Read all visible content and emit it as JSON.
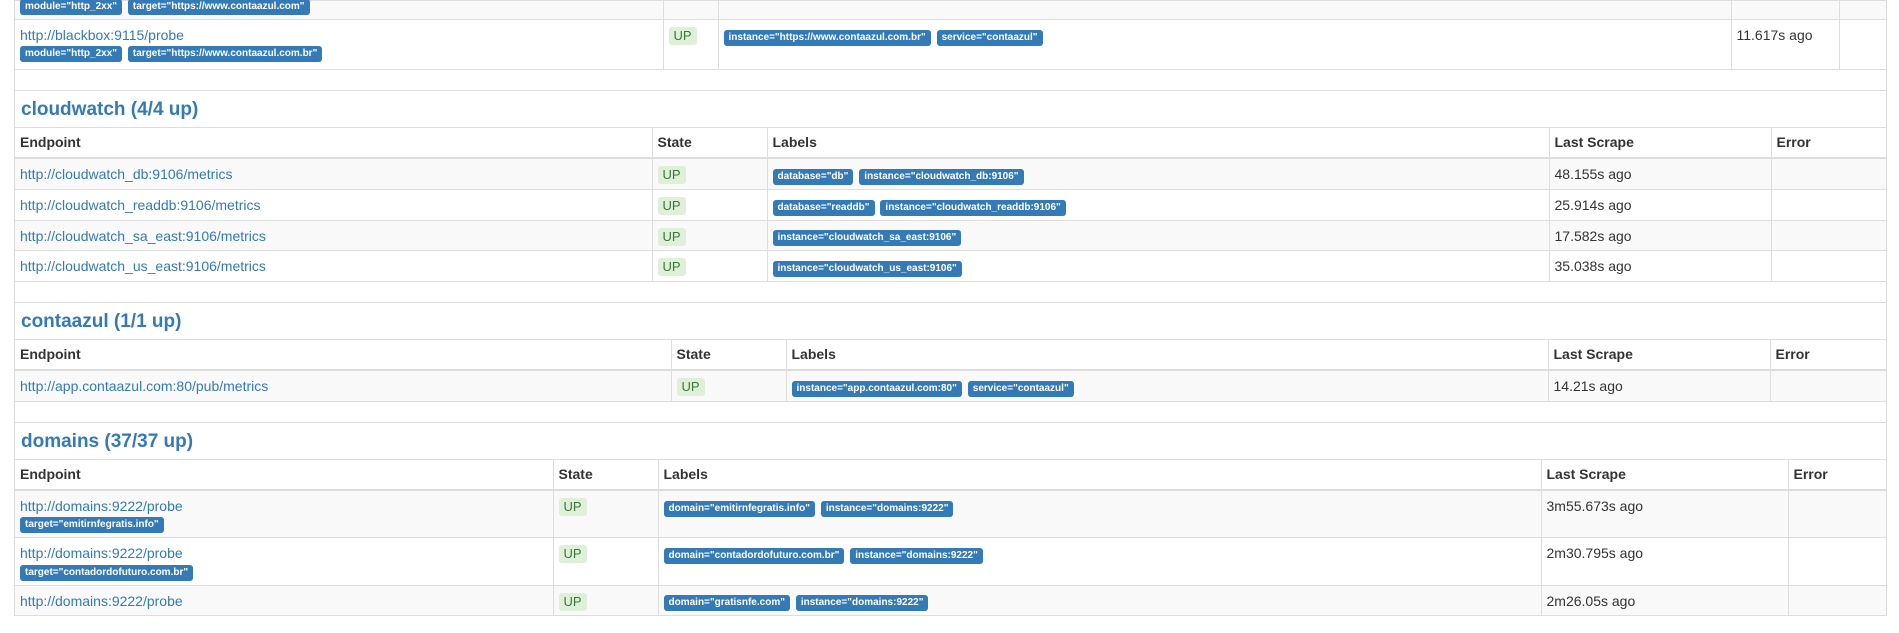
{
  "columns": {
    "endpoint": "Endpoint",
    "state": "State",
    "labels": "Labels",
    "last_scrape": "Last Scrape",
    "error": "Error"
  },
  "top_partial": {
    "row1": {
      "sublabels": [
        "module=\"http_2xx\"",
        "target=\"https://www.contaazul.com\""
      ]
    },
    "row2": {
      "endpoint": "http://blackbox:9115/probe",
      "sublabels": [
        "module=\"http_2xx\"",
        "target=\"https://www.contaazul.com.br\""
      ],
      "state": "UP",
      "labels": [
        "instance=\"https://www.contaazul.com.br\"",
        "service=\"contaazul\""
      ],
      "last_scrape": "11.617s ago"
    }
  },
  "jobs": [
    {
      "title": "cloudwatch (4/4 up)",
      "rows": [
        {
          "endpoint": "http://cloudwatch_db:9106/metrics",
          "state": "UP",
          "labels": [
            "database=\"db\"",
            "instance=\"cloudwatch_db:9106\""
          ],
          "last_scrape": "48.155s ago"
        },
        {
          "endpoint": "http://cloudwatch_readdb:9106/metrics",
          "state": "UP",
          "labels": [
            "database=\"readdb\"",
            "instance=\"cloudwatch_readdb:9106\""
          ],
          "last_scrape": "25.914s ago"
        },
        {
          "endpoint": "http://cloudwatch_sa_east:9106/metrics",
          "state": "UP",
          "labels": [
            "instance=\"cloudwatch_sa_east:9106\""
          ],
          "last_scrape": "17.582s ago"
        },
        {
          "endpoint": "http://cloudwatch_us_east:9106/metrics",
          "state": "UP",
          "labels": [
            "instance=\"cloudwatch_us_east:9106\""
          ],
          "last_scrape": "35.038s ago"
        }
      ]
    },
    {
      "title": "contaazul (1/1 up)",
      "rows": [
        {
          "endpoint": "http://app.contaazul.com:80/pub/metrics",
          "state": "UP",
          "labels": [
            "instance=\"app.contaazul.com:80\"",
            "service=\"contaazul\""
          ],
          "last_scrape": "14.21s ago"
        }
      ]
    },
    {
      "title": "domains (37/37 up)",
      "rows": [
        {
          "endpoint": "http://domains:9222/probe",
          "sublabels": [
            "target=\"emitirnfegratis.info\""
          ],
          "state": "UP",
          "labels": [
            "domain=\"emitirnfegratis.info\"",
            "instance=\"domains:9222\""
          ],
          "last_scrape": "3m55.673s ago"
        },
        {
          "endpoint": "http://domains:9222/probe",
          "sublabels": [
            "target=\"contadordofuturo.com.br\""
          ],
          "state": "UP",
          "labels": [
            "domain=\"contadordofuturo.com.br\"",
            "instance=\"domains:9222\""
          ],
          "last_scrape": "2m30.795s ago"
        },
        {
          "endpoint": "http://domains:9222/probe",
          "state": "UP",
          "labels": [
            "domain=\"gratisnfe.com\"",
            "instance=\"domains:9222\""
          ],
          "last_scrape": "2m26.05s ago"
        }
      ]
    }
  ]
}
